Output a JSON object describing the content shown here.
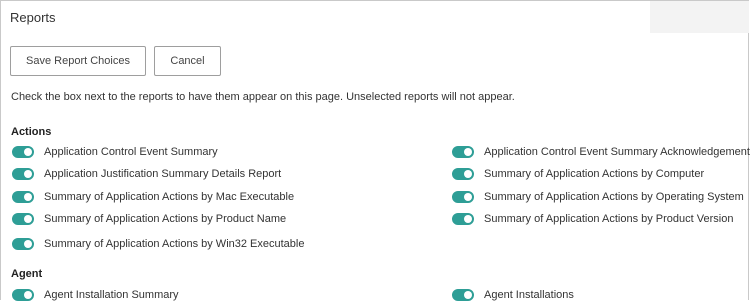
{
  "header": {
    "title": "Reports"
  },
  "buttons": {
    "save_label": "Save Report Choices",
    "cancel_label": "Cancel"
  },
  "instructions": "Check the box next to the reports to have them appear on this page. Unselected reports will not appear.",
  "colors": {
    "toggle_on": "#2e9e96",
    "border": "#c9c9c9"
  },
  "sections": [
    {
      "title": "Actions",
      "items": [
        {
          "label": "Application Control Event Summary",
          "enabled": true
        },
        {
          "label": "Application Control Event Summary Acknowledgements",
          "enabled": true
        },
        {
          "label": "Application Justification Summary Details Report",
          "enabled": true
        },
        {
          "label": "Summary of Application Actions by Computer",
          "enabled": true
        },
        {
          "label": "Summary of Application Actions by Mac Executable",
          "enabled": true
        },
        {
          "label": "Summary of Application Actions by Operating System",
          "enabled": true
        },
        {
          "label": "Summary of Application Actions by Product Name",
          "enabled": true
        },
        {
          "label": "Summary of Application Actions by Product Version",
          "enabled": true
        },
        {
          "label": "Summary of Application Actions by Win32 Executable",
          "enabled": true
        }
      ]
    },
    {
      "title": "Agent",
      "items": [
        {
          "label": "Agent Installation Summary",
          "enabled": true
        },
        {
          "label": "Agent Installations",
          "enabled": true
        }
      ]
    }
  ]
}
